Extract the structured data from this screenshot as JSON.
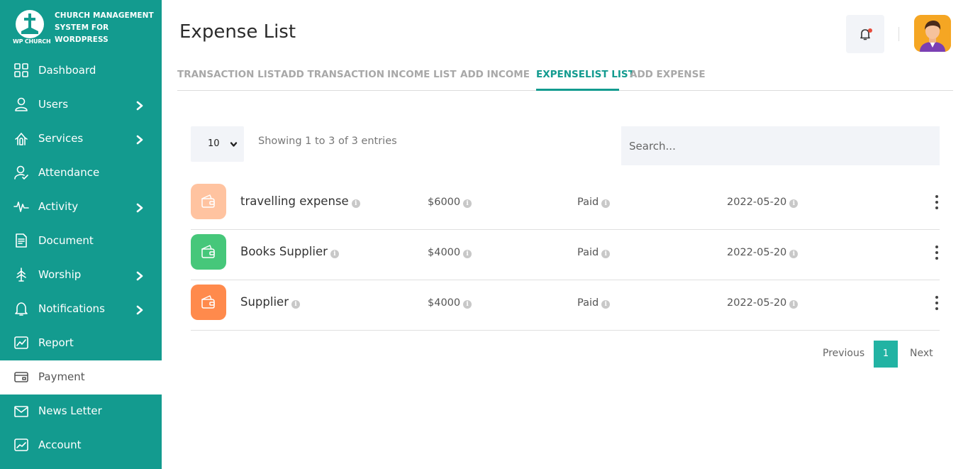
{
  "brand": {
    "title": "CHURCH MANAGEMENT SYSTEM FOR WORDPRESS",
    "logo_text": "WP CHURCH"
  },
  "sidebar": {
    "items": [
      {
        "label": "Dashboard",
        "icon": "grid-icon",
        "has_submenu": false,
        "active": false
      },
      {
        "label": "Users",
        "icon": "user-icon",
        "has_submenu": true,
        "active": false
      },
      {
        "label": "Services",
        "icon": "services-icon",
        "has_submenu": true,
        "active": false
      },
      {
        "label": "Attendance",
        "icon": "attendance-icon",
        "has_submenu": false,
        "active": false
      },
      {
        "label": "Activity",
        "icon": "pulse-icon",
        "has_submenu": true,
        "active": false
      },
      {
        "label": "Document",
        "icon": "document-icon",
        "has_submenu": false,
        "active": false
      },
      {
        "label": "Worship",
        "icon": "worship-icon",
        "has_submenu": true,
        "active": false
      },
      {
        "label": "Notifications",
        "icon": "bell-icon",
        "has_submenu": true,
        "active": false
      },
      {
        "label": "Report",
        "icon": "report-icon",
        "has_submenu": false,
        "active": false
      },
      {
        "label": "Payment",
        "icon": "payment-icon",
        "has_submenu": false,
        "active": true
      },
      {
        "label": "News Letter",
        "icon": "newsletter-icon",
        "has_submenu": false,
        "active": false
      },
      {
        "label": "Account",
        "icon": "account-icon",
        "has_submenu": false,
        "active": false
      }
    ]
  },
  "header": {
    "title": "Expense List"
  },
  "tabs": [
    {
      "label": "TRANSACTION LIST",
      "active": false
    },
    {
      "label": "ADD TRANSACTION",
      "active": false
    },
    {
      "label": "INCOME LIST",
      "active": false
    },
    {
      "label": "ADD INCOME",
      "active": false
    },
    {
      "label": "EXPENSELIST LIST",
      "active": true
    },
    {
      "label": "ADD EXPENSE",
      "active": false
    }
  ],
  "table": {
    "page_length": "10",
    "showing_text": "Showing 1 to 3 of 3 entries",
    "search_placeholder": "Search...",
    "rows": [
      {
        "name": "travelling expense",
        "amount": "$6000",
        "status": "Paid",
        "date": "2022-05-20",
        "icon_color": "#ffc3a0"
      },
      {
        "name": "Books Supplier",
        "amount": "$4000",
        "status": "Paid",
        "date": "2022-05-20",
        "icon_color": "#46c77a"
      },
      {
        "name": "Supplier",
        "amount": "$4000",
        "status": "Paid",
        "date": "2022-05-20",
        "icon_color": "#ff8a4c"
      }
    ]
  },
  "pagination": {
    "previous": "Previous",
    "current": "1",
    "next": "Next"
  },
  "colors": {
    "sidebar": "#139b8f",
    "accent": "#139b8f",
    "page_active": "#22b3a3"
  }
}
